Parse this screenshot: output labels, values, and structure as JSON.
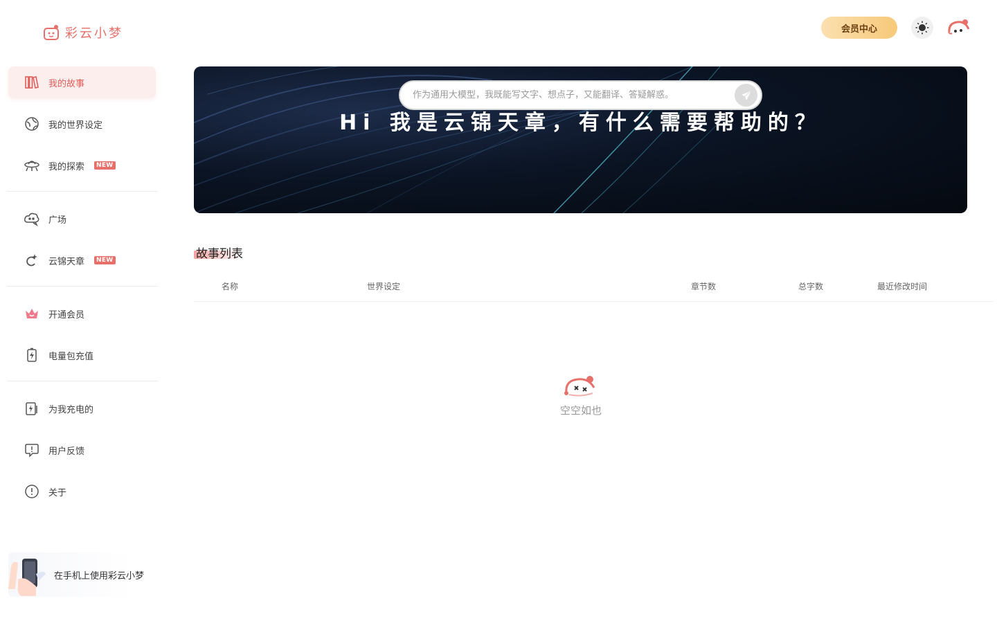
{
  "app": {
    "name": "彩云小梦"
  },
  "sidebar": {
    "items": [
      {
        "label": "我的故事",
        "icon": "bookshelf-icon",
        "active": true
      },
      {
        "label": "我的世界设定",
        "icon": "planet-icon",
        "active": false
      },
      {
        "label": "我的探索",
        "icon": "ufo-icon",
        "badge": "NEW",
        "active": false
      },
      {
        "label": "广场",
        "icon": "cloud-chat-icon",
        "active": false
      },
      {
        "label": "云锦天章",
        "icon": "sparkle-c-icon",
        "badge": "NEW",
        "active": false
      },
      {
        "label": "开通会员",
        "icon": "crown-icon",
        "active": false
      },
      {
        "label": "电量包充值",
        "icon": "battery-bolt-icon",
        "active": false
      },
      {
        "label": "为我充电的",
        "icon": "charge-doc-icon",
        "active": false
      },
      {
        "label": "用户反馈",
        "icon": "feedback-icon",
        "active": false
      },
      {
        "label": "关于",
        "icon": "info-icon",
        "active": false
      }
    ],
    "promo": {
      "label": "在手机上使用彩云小梦"
    }
  },
  "header": {
    "vip_label": "会员中心",
    "theme_icon": "sun-icon",
    "avatar_icon": "mascot-avatar-icon"
  },
  "banner": {
    "title": "Hi 我是云锦天章，有什么需要帮助的？",
    "input_placeholder": "作为通用大模型，我既能写文字、想点子，又能翻译、答疑解惑。",
    "send_icon": "paper-plane-icon"
  },
  "story_list": {
    "title": "故事列表",
    "columns": [
      "名称",
      "世界设定",
      "章节数",
      "总字数",
      "最近修改时间"
    ],
    "rows": [],
    "empty_text": "空空如也"
  },
  "colors": {
    "brand": "#e8706a",
    "active_bg": "#fdeeee",
    "vip_gradient_start": "#fbe0b0",
    "vip_gradient_end": "#f7c979",
    "banner_dark": "#050910"
  }
}
